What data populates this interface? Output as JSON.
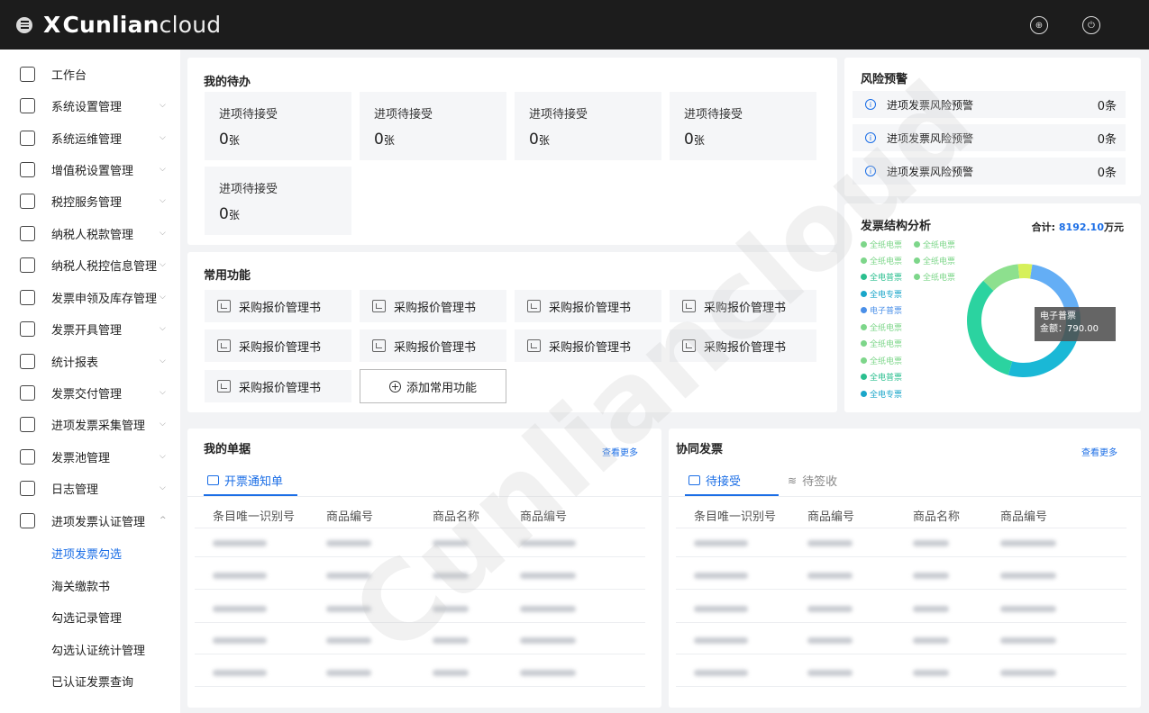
{
  "app": {
    "logo_bold": "Cunlian",
    "logo_light": "cloud",
    "logo_prefix": "X"
  },
  "sidebar": {
    "items": [
      {
        "label": "工作台",
        "icon": "dashboard-icon",
        "chevron": ""
      },
      {
        "label": "系统设置管理",
        "icon": "gear-icon",
        "chevron": "⌵"
      },
      {
        "label": "系统运维管理",
        "icon": "monitor-icon",
        "chevron": "⌵"
      },
      {
        "label": "增值税设置管理",
        "icon": "document-icon",
        "chevron": "⌵"
      },
      {
        "label": "税控服务管理",
        "icon": "tax-service-icon",
        "chevron": "⌵"
      },
      {
        "label": "纳税人税款管理",
        "icon": "tax-payment-icon",
        "chevron": "⌵"
      },
      {
        "label": "纳税人税控信息管理",
        "icon": "grid-icon",
        "chevron": "⌵"
      },
      {
        "label": "发票申领及库存管理",
        "icon": "file-icon",
        "chevron": "⌵"
      },
      {
        "label": "发票开具管理",
        "icon": "invoice-icon",
        "chevron": "⌵"
      },
      {
        "label": "统计报表",
        "icon": "chart-icon",
        "chevron": "⌵"
      },
      {
        "label": "发票交付管理",
        "icon": "delivery-icon",
        "chevron": "⌵"
      },
      {
        "label": "进项发票采集管理",
        "icon": "collect-icon",
        "chevron": "⌵"
      },
      {
        "label": "发票池管理",
        "icon": "pool-icon",
        "chevron": "⌵"
      },
      {
        "label": "日志管理",
        "icon": "log-icon",
        "chevron": "⌵"
      },
      {
        "label": "进项发票认证管理",
        "icon": "certify-icon",
        "chevron": "^"
      }
    ],
    "subitems": [
      {
        "label": "进项发票勾选",
        "active": true
      },
      {
        "label": "海关缴款书",
        "active": false
      },
      {
        "label": "勾选记录管理",
        "active": false
      },
      {
        "label": "勾选认证统计管理",
        "active": false
      },
      {
        "label": "已认证发票查询",
        "active": false
      }
    ]
  },
  "todo": {
    "title": "我的待办",
    "items": [
      {
        "label": "进项待接受",
        "value": "0",
        "unit": "张"
      },
      {
        "label": "进项待接受",
        "value": "0",
        "unit": "张"
      },
      {
        "label": "进项待接受",
        "value": "0",
        "unit": "张"
      },
      {
        "label": "进项待接受",
        "value": "0",
        "unit": "张"
      },
      {
        "label": "进项待接受",
        "value": "0",
        "unit": "张"
      }
    ]
  },
  "risk": {
    "title": "风险预警",
    "items": [
      {
        "label": "进项发票风险预警",
        "value": "0条"
      },
      {
        "label": "进项发票风险预警",
        "value": "0条"
      },
      {
        "label": "进项发票风险预警",
        "value": "0条"
      }
    ]
  },
  "functions": {
    "title": "常用功能",
    "items": [
      "采购报价管理书",
      "采购报价管理书",
      "采购报价管理书",
      "采购报价管理书",
      "采购报价管理书",
      "采购报价管理书",
      "采购报价管理书",
      "采购报价管理书",
      "采购报价管理书"
    ],
    "add_label": "添加常用功能"
  },
  "analysis": {
    "title": "发票结构分析",
    "total_label": "合计:",
    "total_value": "8192.10",
    "total_unit": "万元",
    "legend": [
      {
        "label": "全纸电票",
        "color": "#7dd68a"
      },
      {
        "label": "全纸电票",
        "color": "#7dd68a"
      },
      {
        "label": "全纸电票",
        "color": "#7dd68a"
      },
      {
        "label": "全纸电票",
        "color": "#7dd68a"
      },
      {
        "label": "全电普票",
        "color": "#2bbf8f"
      },
      {
        "label": "全纸电票",
        "color": "#7dd68a"
      },
      {
        "label": "全电专票",
        "color": "#1aa6c9"
      },
      {
        "label": "电子普票",
        "color": "#4a8fe8"
      },
      {
        "label": "全纸电票",
        "color": "#7dd68a"
      },
      {
        "label": "全纸电票",
        "color": "#7dd68a"
      },
      {
        "label": "全纸电票",
        "color": "#7dd68a"
      },
      {
        "label": "全电普票",
        "color": "#2bbf8f"
      },
      {
        "label": "全电专票",
        "color": "#1aa6c9"
      }
    ],
    "tooltip_title": "电子普票",
    "tooltip_value": "金额：790.00"
  },
  "chart_data": {
    "type": "pie",
    "title": "发票结构分析",
    "categories": [
      "电子普票",
      "全电专票",
      "全电普票",
      "全纸电票",
      "全纸电票"
    ],
    "values": [
      20,
      32,
      33,
      11,
      4
    ],
    "colors": [
      "#64aef5",
      "#1ab8d6",
      "#2bd3a0",
      "#8de08e",
      "#d6f05a"
    ],
    "total": 8192.1
  },
  "my_docs": {
    "title": "我的单据",
    "more": "查看更多",
    "tab": "开票通知单",
    "columns": [
      "条目唯一识别号",
      "商品编号",
      "商品名称",
      "商品编号"
    ]
  },
  "collab": {
    "title": "协同发票",
    "more": "查看更多",
    "tabs": [
      "待接受",
      "待签收"
    ],
    "columns": [
      "条目唯一识别号",
      "商品编号",
      "商品名称",
      "商品编号"
    ]
  },
  "watermark": "Cunliancloud"
}
